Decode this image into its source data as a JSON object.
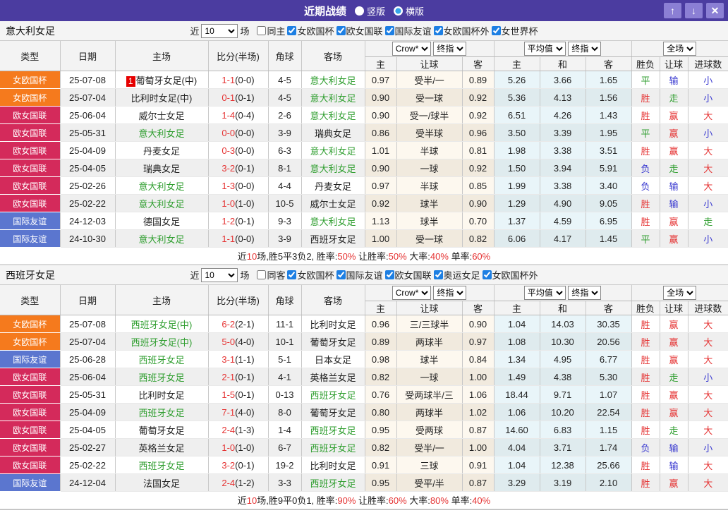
{
  "titlebar": {
    "title": "近期战绩",
    "options": [
      {
        "label": "竖版",
        "selected": false
      },
      {
        "label": "横版",
        "selected": true
      }
    ],
    "buttons": {
      "up": "↑",
      "down": "↓",
      "close": "✕"
    }
  },
  "columns": {
    "type": "类型",
    "date": "日期",
    "home": "主场",
    "score": "比分(半场)",
    "corner": "角球",
    "away": "客场",
    "odds_source": "Crow*",
    "odds_time": "终指",
    "avg_source": "平均值",
    "avg_time": "终指",
    "scope": "全场",
    "sub": [
      "主",
      "让球",
      "客",
      "主",
      "和",
      "客",
      "胜负",
      "让球",
      "进球数"
    ]
  },
  "filter_common": {
    "prefix": "近",
    "suffix": "场"
  },
  "league_colors": {
    "女欧国杯": "#f57a1d",
    "欧女国联": "#d42a5b",
    "国际友谊": "#5b76cf"
  },
  "result_colors": {
    "r": "#e53333",
    "g": "#2f9e2f",
    "b": "#3a3ad0"
  },
  "sections": [
    {
      "team": "意大利女足",
      "filter": {
        "count": "10",
        "checkboxes": [
          {
            "label": "同主",
            "checked": false
          },
          {
            "label": "女欧国杯",
            "checked": true
          },
          {
            "label": "欧女国联",
            "checked": true
          },
          {
            "label": "国际友谊",
            "checked": true
          },
          {
            "label": "女欧国杯外",
            "checked": true
          },
          {
            "label": "女世界杯",
            "checked": true
          }
        ]
      },
      "rows": [
        {
          "lg": "女欧国杯",
          "date": "25-07-08",
          "badge": "1",
          "home": "葡萄牙女足(中)",
          "hg": 0,
          "fs": "1-1",
          "hs": "(0-0)",
          "cn": "4-5",
          "away": "意大利女足",
          "ag": 1,
          "o1": "0.97",
          "hc": "受半/一",
          "o2": "0.89",
          "a1": "5.26",
          "a2": "3.66",
          "a3": "1.65",
          "res": [
            [
              "平",
              "g"
            ],
            [
              "输",
              "b"
            ],
            [
              "小",
              "b"
            ]
          ]
        },
        {
          "lg": "女欧国杯",
          "date": "25-07-04",
          "home": "比利时女足(中)",
          "hg": 0,
          "fs": "0-1",
          "hs": "(0-1)",
          "cn": "4-5",
          "away": "意大利女足",
          "ag": 1,
          "o1": "0.90",
          "hc": "受一球",
          "o2": "0.92",
          "a1": "5.36",
          "a2": "4.13",
          "a3": "1.56",
          "res": [
            [
              "胜",
              "r"
            ],
            [
              "走",
              "g"
            ],
            [
              "小",
              "b"
            ]
          ]
        },
        {
          "lg": "欧女国联",
          "date": "25-06-04",
          "home": "威尔士女足",
          "hg": 0,
          "fs": "1-4",
          "hs": "(0-4)",
          "cn": "2-6",
          "away": "意大利女足",
          "ag": 1,
          "o1": "0.90",
          "hc": "受一/球半",
          "o2": "0.92",
          "a1": "6.51",
          "a2": "4.26",
          "a3": "1.43",
          "res": [
            [
              "胜",
              "r"
            ],
            [
              "赢",
              "r"
            ],
            [
              "大",
              "r"
            ]
          ]
        },
        {
          "lg": "欧女国联",
          "date": "25-05-31",
          "home": "意大利女足",
          "hg": 1,
          "fs": "0-0",
          "hs": "(0-0)",
          "cn": "3-9",
          "away": "瑞典女足",
          "ag": 0,
          "o1": "0.86",
          "hc": "受半球",
          "o2": "0.96",
          "a1": "3.50",
          "a2": "3.39",
          "a3": "1.95",
          "res": [
            [
              "平",
              "g"
            ],
            [
              "赢",
              "r"
            ],
            [
              "小",
              "b"
            ]
          ]
        },
        {
          "lg": "欧女国联",
          "date": "25-04-09",
          "home": "丹麦女足",
          "hg": 0,
          "fs": "0-3",
          "hs": "(0-0)",
          "cn": "6-3",
          "away": "意大利女足",
          "ag": 1,
          "o1": "1.01",
          "hc": "半球",
          "o2": "0.81",
          "a1": "1.98",
          "a2": "3.38",
          "a3": "3.51",
          "res": [
            [
              "胜",
              "r"
            ],
            [
              "赢",
              "r"
            ],
            [
              "大",
              "r"
            ]
          ]
        },
        {
          "lg": "欧女国联",
          "date": "25-04-05",
          "home": "瑞典女足",
          "hg": 0,
          "fs": "3-2",
          "hs": "(0-1)",
          "cn": "8-1",
          "away": "意大利女足",
          "ag": 1,
          "o1": "0.90",
          "hc": "一球",
          "o2": "0.92",
          "a1": "1.50",
          "a2": "3.94",
          "a3": "5.91",
          "res": [
            [
              "负",
              "b"
            ],
            [
              "走",
              "g"
            ],
            [
              "大",
              "r"
            ]
          ]
        },
        {
          "lg": "欧女国联",
          "date": "25-02-26",
          "home": "意大利女足",
          "hg": 1,
          "fs": "1-3",
          "hs": "(0-0)",
          "cn": "4-4",
          "away": "丹麦女足",
          "ag": 0,
          "o1": "0.97",
          "hc": "半球",
          "o2": "0.85",
          "a1": "1.99",
          "a2": "3.38",
          "a3": "3.40",
          "res": [
            [
              "负",
              "b"
            ],
            [
              "输",
              "b"
            ],
            [
              "大",
              "r"
            ]
          ]
        },
        {
          "lg": "欧女国联",
          "date": "25-02-22",
          "home": "意大利女足",
          "hg": 1,
          "fs": "1-0",
          "hs": "(1-0)",
          "cn": "10-5",
          "away": "威尔士女足",
          "ag": 0,
          "o1": "0.92",
          "hc": "球半",
          "o2": "0.90",
          "a1": "1.29",
          "a2": "4.90",
          "a3": "9.05",
          "res": [
            [
              "胜",
              "r"
            ],
            [
              "输",
              "b"
            ],
            [
              "小",
              "b"
            ]
          ]
        },
        {
          "lg": "国际友谊",
          "date": "24-12-03",
          "home": "德国女足",
          "hg": 0,
          "fs": "1-2",
          "hs": "(0-1)",
          "cn": "9-3",
          "away": "意大利女足",
          "ag": 1,
          "o1": "1.13",
          "hc": "球半",
          "o2": "0.70",
          "a1": "1.37",
          "a2": "4.59",
          "a3": "6.95",
          "res": [
            [
              "胜",
              "r"
            ],
            [
              "赢",
              "r"
            ],
            [
              "走",
              "g"
            ]
          ]
        },
        {
          "lg": "国际友谊",
          "date": "24-10-30",
          "home": "意大利女足",
          "hg": 1,
          "fs": "1-1",
          "hs": "(0-0)",
          "cn": "3-9",
          "away": "西班牙女足",
          "ag": 0,
          "o1": "1.00",
          "hc": "受一球",
          "o2": "0.82",
          "a1": "6.06",
          "a2": "4.17",
          "a3": "1.45",
          "res": [
            [
              "平",
              "g"
            ],
            [
              "赢",
              "r"
            ],
            [
              "小",
              "b"
            ]
          ]
        }
      ],
      "summary": [
        {
          "t": "近"
        },
        {
          "t": "10",
          "red": true
        },
        {
          "t": "场,胜5平3负2, 胜率:"
        },
        {
          "t": "50%",
          "red": true
        },
        {
          "t": " 让胜率:"
        },
        {
          "t": "50%",
          "red": true
        },
        {
          "t": " 大率:"
        },
        {
          "t": "40%",
          "red": true
        },
        {
          "t": " 单率:"
        },
        {
          "t": "60%",
          "red": true
        }
      ]
    },
    {
      "team": "西班牙女足",
      "filter": {
        "count": "10",
        "checkboxes": [
          {
            "label": "同客",
            "checked": false
          },
          {
            "label": "女欧国杯",
            "checked": true
          },
          {
            "label": "国际友谊",
            "checked": true
          },
          {
            "label": "欧女国联",
            "checked": true
          },
          {
            "label": "奥运女足",
            "checked": true
          },
          {
            "label": "女欧国杯外",
            "checked": true
          }
        ]
      },
      "rows": [
        {
          "lg": "女欧国杯",
          "date": "25-07-08",
          "home": "西班牙女足(中)",
          "hg": 1,
          "fs": "6-2",
          "hs": "(2-1)",
          "cn": "11-1",
          "away": "比利时女足",
          "ag": 0,
          "o1": "0.96",
          "hc": "三/三球半",
          "o2": "0.90",
          "a1": "1.04",
          "a2": "14.03",
          "a3": "30.35",
          "res": [
            [
              "胜",
              "r"
            ],
            [
              "赢",
              "r"
            ],
            [
              "大",
              "r"
            ]
          ]
        },
        {
          "lg": "女欧国杯",
          "date": "25-07-04",
          "home": "西班牙女足(中)",
          "hg": 1,
          "fs": "5-0",
          "hs": "(4-0)",
          "cn": "10-1",
          "away": "葡萄牙女足",
          "ag": 0,
          "o1": "0.89",
          "hc": "两球半",
          "o2": "0.97",
          "a1": "1.08",
          "a2": "10.30",
          "a3": "20.56",
          "res": [
            [
              "胜",
              "r"
            ],
            [
              "赢",
              "r"
            ],
            [
              "大",
              "r"
            ]
          ]
        },
        {
          "lg": "国际友谊",
          "date": "25-06-28",
          "home": "西班牙女足",
          "hg": 1,
          "fs": "3-1",
          "hs": "(1-1)",
          "cn": "5-1",
          "away": "日本女足",
          "ag": 0,
          "o1": "0.98",
          "hc": "球半",
          "o2": "0.84",
          "a1": "1.34",
          "a2": "4.95",
          "a3": "6.77",
          "res": [
            [
              "胜",
              "r"
            ],
            [
              "赢",
              "r"
            ],
            [
              "大",
              "r"
            ]
          ]
        },
        {
          "lg": "欧女国联",
          "date": "25-06-04",
          "home": "西班牙女足",
          "hg": 1,
          "fs": "2-1",
          "hs": "(0-1)",
          "cn": "4-1",
          "away": "英格兰女足",
          "ag": 0,
          "o1": "0.82",
          "hc": "一球",
          "o2": "1.00",
          "a1": "1.49",
          "a2": "4.38",
          "a3": "5.30",
          "res": [
            [
              "胜",
              "r"
            ],
            [
              "走",
              "g"
            ],
            [
              "小",
              "b"
            ]
          ]
        },
        {
          "lg": "欧女国联",
          "date": "25-05-31",
          "home": "比利时女足",
          "hg": 0,
          "fs": "1-5",
          "hs": "(0-1)",
          "cn": "0-13",
          "away": "西班牙女足",
          "ag": 1,
          "o1": "0.76",
          "hc": "受两球半/三",
          "o2": "1.06",
          "a1": "18.44",
          "a2": "9.71",
          "a3": "1.07",
          "res": [
            [
              "胜",
              "r"
            ],
            [
              "赢",
              "r"
            ],
            [
              "大",
              "r"
            ]
          ]
        },
        {
          "lg": "欧女国联",
          "date": "25-04-09",
          "home": "西班牙女足",
          "hg": 1,
          "fs": "7-1",
          "hs": "(4-0)",
          "cn": "8-0",
          "away": "葡萄牙女足",
          "ag": 0,
          "o1": "0.80",
          "hc": "两球半",
          "o2": "1.02",
          "a1": "1.06",
          "a2": "10.20",
          "a3": "22.54",
          "res": [
            [
              "胜",
              "r"
            ],
            [
              "赢",
              "r"
            ],
            [
              "大",
              "r"
            ]
          ]
        },
        {
          "lg": "欧女国联",
          "date": "25-04-05",
          "home": "葡萄牙女足",
          "hg": 0,
          "fs": "2-4",
          "hs": "(1-3)",
          "cn": "1-4",
          "away": "西班牙女足",
          "ag": 1,
          "o1": "0.95",
          "hc": "受两球",
          "o2": "0.87",
          "a1": "14.60",
          "a2": "6.83",
          "a3": "1.15",
          "res": [
            [
              "胜",
              "r"
            ],
            [
              "走",
              "g"
            ],
            [
              "大",
              "r"
            ]
          ]
        },
        {
          "lg": "欧女国联",
          "date": "25-02-27",
          "home": "英格兰女足",
          "hg": 0,
          "fs": "1-0",
          "hs": "(1-0)",
          "cn": "6-7",
          "away": "西班牙女足",
          "ag": 1,
          "o1": "0.82",
          "hc": "受半/一",
          "o2": "1.00",
          "a1": "4.04",
          "a2": "3.71",
          "a3": "1.74",
          "res": [
            [
              "负",
              "b"
            ],
            [
              "输",
              "b"
            ],
            [
              "小",
              "b"
            ]
          ]
        },
        {
          "lg": "欧女国联",
          "date": "25-02-22",
          "home": "西班牙女足",
          "hg": 1,
          "fs": "3-2",
          "hs": "(0-1)",
          "cn": "19-2",
          "away": "比利时女足",
          "ag": 0,
          "o1": "0.91",
          "hc": "三球",
          "o2": "0.91",
          "a1": "1.04",
          "a2": "12.38",
          "a3": "25.66",
          "res": [
            [
              "胜",
              "r"
            ],
            [
              "输",
              "b"
            ],
            [
              "大",
              "r"
            ]
          ]
        },
        {
          "lg": "国际友谊",
          "date": "24-12-04",
          "home": "法国女足",
          "hg": 0,
          "fs": "2-4",
          "hs": "(1-2)",
          "cn": "3-3",
          "away": "西班牙女足",
          "ag": 1,
          "o1": "0.95",
          "hc": "受平/半",
          "o2": "0.87",
          "a1": "3.29",
          "a2": "3.19",
          "a3": "2.10",
          "res": [
            [
              "胜",
              "r"
            ],
            [
              "赢",
              "r"
            ],
            [
              "大",
              "r"
            ]
          ]
        }
      ],
      "summary": [
        {
          "t": "近"
        },
        {
          "t": "10",
          "red": true
        },
        {
          "t": "场,胜9平0负1, 胜率:"
        },
        {
          "t": "90%",
          "red": true
        },
        {
          "t": " 让胜率:"
        },
        {
          "t": "60%",
          "red": true
        },
        {
          "t": " 大率:"
        },
        {
          "t": "80%",
          "red": true
        },
        {
          "t": " 单率:"
        },
        {
          "t": "40%",
          "red": true
        }
      ]
    }
  ]
}
